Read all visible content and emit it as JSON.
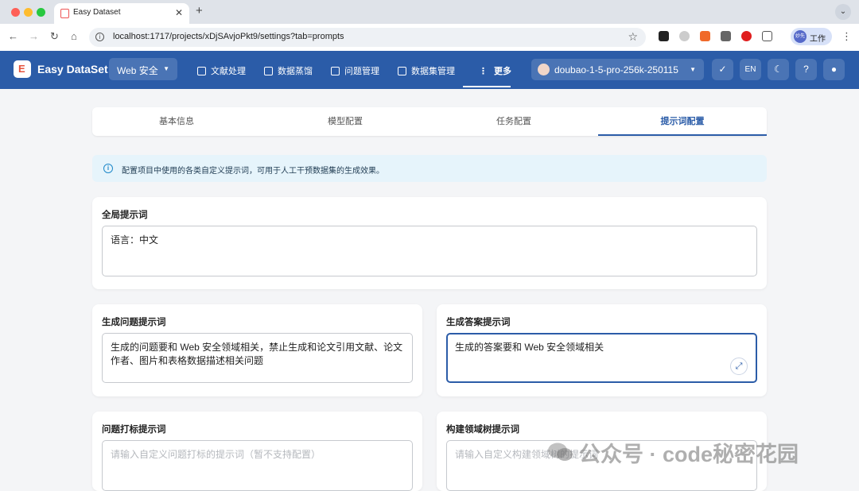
{
  "browser": {
    "tab_title": "Easy Dataset",
    "url": "localhost:1717/projects/xDjSAvjoPkt9/settings?tab=prompts",
    "profile_label": "工作",
    "profile_avatar": "妙先"
  },
  "header": {
    "brand": "Easy DataSet",
    "project": "Web 安全",
    "nav": [
      "文献处理",
      "数据蒸馏",
      "问题管理",
      "数据集管理",
      "更多"
    ],
    "model": "doubao-1-5-pro-256k-250115",
    "lang": "EN",
    "accent_color": "#2b5ca8"
  },
  "settings_tabs": [
    "基本信息",
    "模型配置",
    "任务配置",
    "提示词配置"
  ],
  "active_tab": "提示词配置",
  "info": "配置项目中使用的各类自定义提示词，可用于人工干预数据集的生成效果。",
  "global_prompt": {
    "label": "全局提示词",
    "value": "语言：中文"
  },
  "question_prompt": {
    "label": "生成问题提示词",
    "value": "生成的问题要和 Web 安全领域相关，禁止生成和论文引用文献、论文作者、图片和表格数据描述相关问题"
  },
  "answer_prompt": {
    "label": "生成答案提示词",
    "value": "生成的答案要和 Web 安全领域相关"
  },
  "label_prompt": {
    "label": "问题打标提示词",
    "placeholder": "请输入自定义问题打标的提示词（暂不支持配置）"
  },
  "domain_tree_prompt": {
    "label": "构建领域树提示词",
    "placeholder": "请输入自定义构建领域树的提示词"
  },
  "watermark": "公众号 · code秘密花园"
}
